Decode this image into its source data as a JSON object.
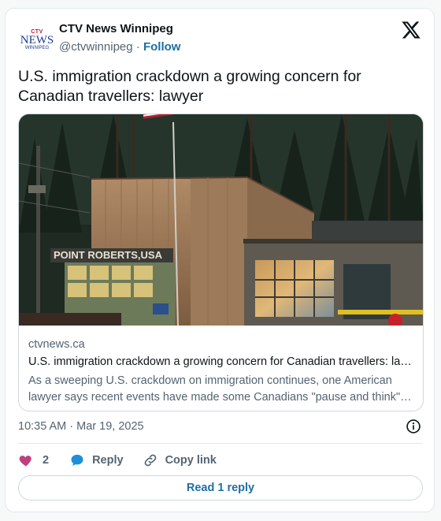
{
  "author": {
    "name": "CTV News Winnipeg",
    "handle": "@ctvwinnipeg",
    "separator": "·",
    "follow_label": "Follow",
    "avatar": {
      "top": "CTV",
      "main": "NEWS",
      "bottom": "WINNIPEG"
    }
  },
  "tweet": {
    "text": "U.S. immigration crackdown a growing concern for Canadian travellers: lawyer"
  },
  "link_card": {
    "sign_text": "POINT ROBERTS,USA",
    "domain": "ctvnews.ca",
    "title": "U.S. immigration crackdown a growing concern for Canadian travellers: lawyer",
    "description": "As a sweeping U.S. crackdown on immigration continues, one American lawyer says recent events have made some Canadians \"pause and think\" before heading south."
  },
  "meta": {
    "timestamp": "10:35 AM · Mar 19, 2025"
  },
  "actions": {
    "like_count": "2",
    "reply_label": "Reply",
    "copy_link_label": "Copy link"
  },
  "read_reply_label": "Read 1 reply",
  "icons": {
    "brand": "x-logo-icon",
    "info": "info-icon",
    "like": "heart-icon",
    "reply": "speech-bubble-icon",
    "copy": "link-icon"
  },
  "colors": {
    "heart": "#c13e7f",
    "reply_bubble": "#1d8fd6",
    "link_accent": "#1d6fa3",
    "text_secondary": "#536471"
  }
}
